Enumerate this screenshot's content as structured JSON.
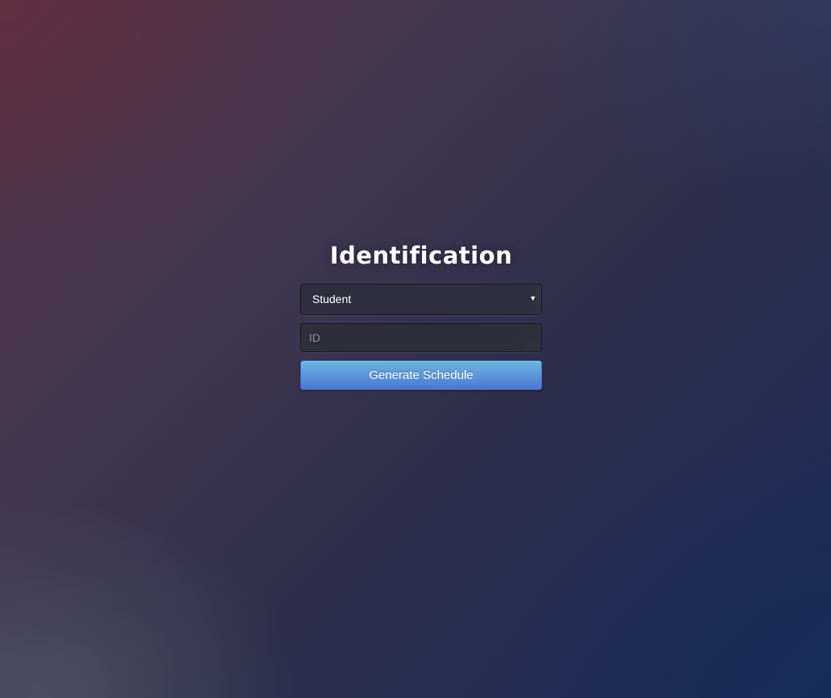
{
  "form": {
    "title": "Identification",
    "role_select": {
      "selected": "Student",
      "arrow_icon": "triangle-down-icon"
    },
    "id_input": {
      "value": "",
      "placeholder": "ID"
    },
    "submit_label": "Generate Schedule"
  },
  "colors": {
    "button_top": "#6eb6de",
    "button_bottom": "#4a77d4",
    "field_background": "#2a2a3c",
    "title_text": "#ffffff"
  }
}
